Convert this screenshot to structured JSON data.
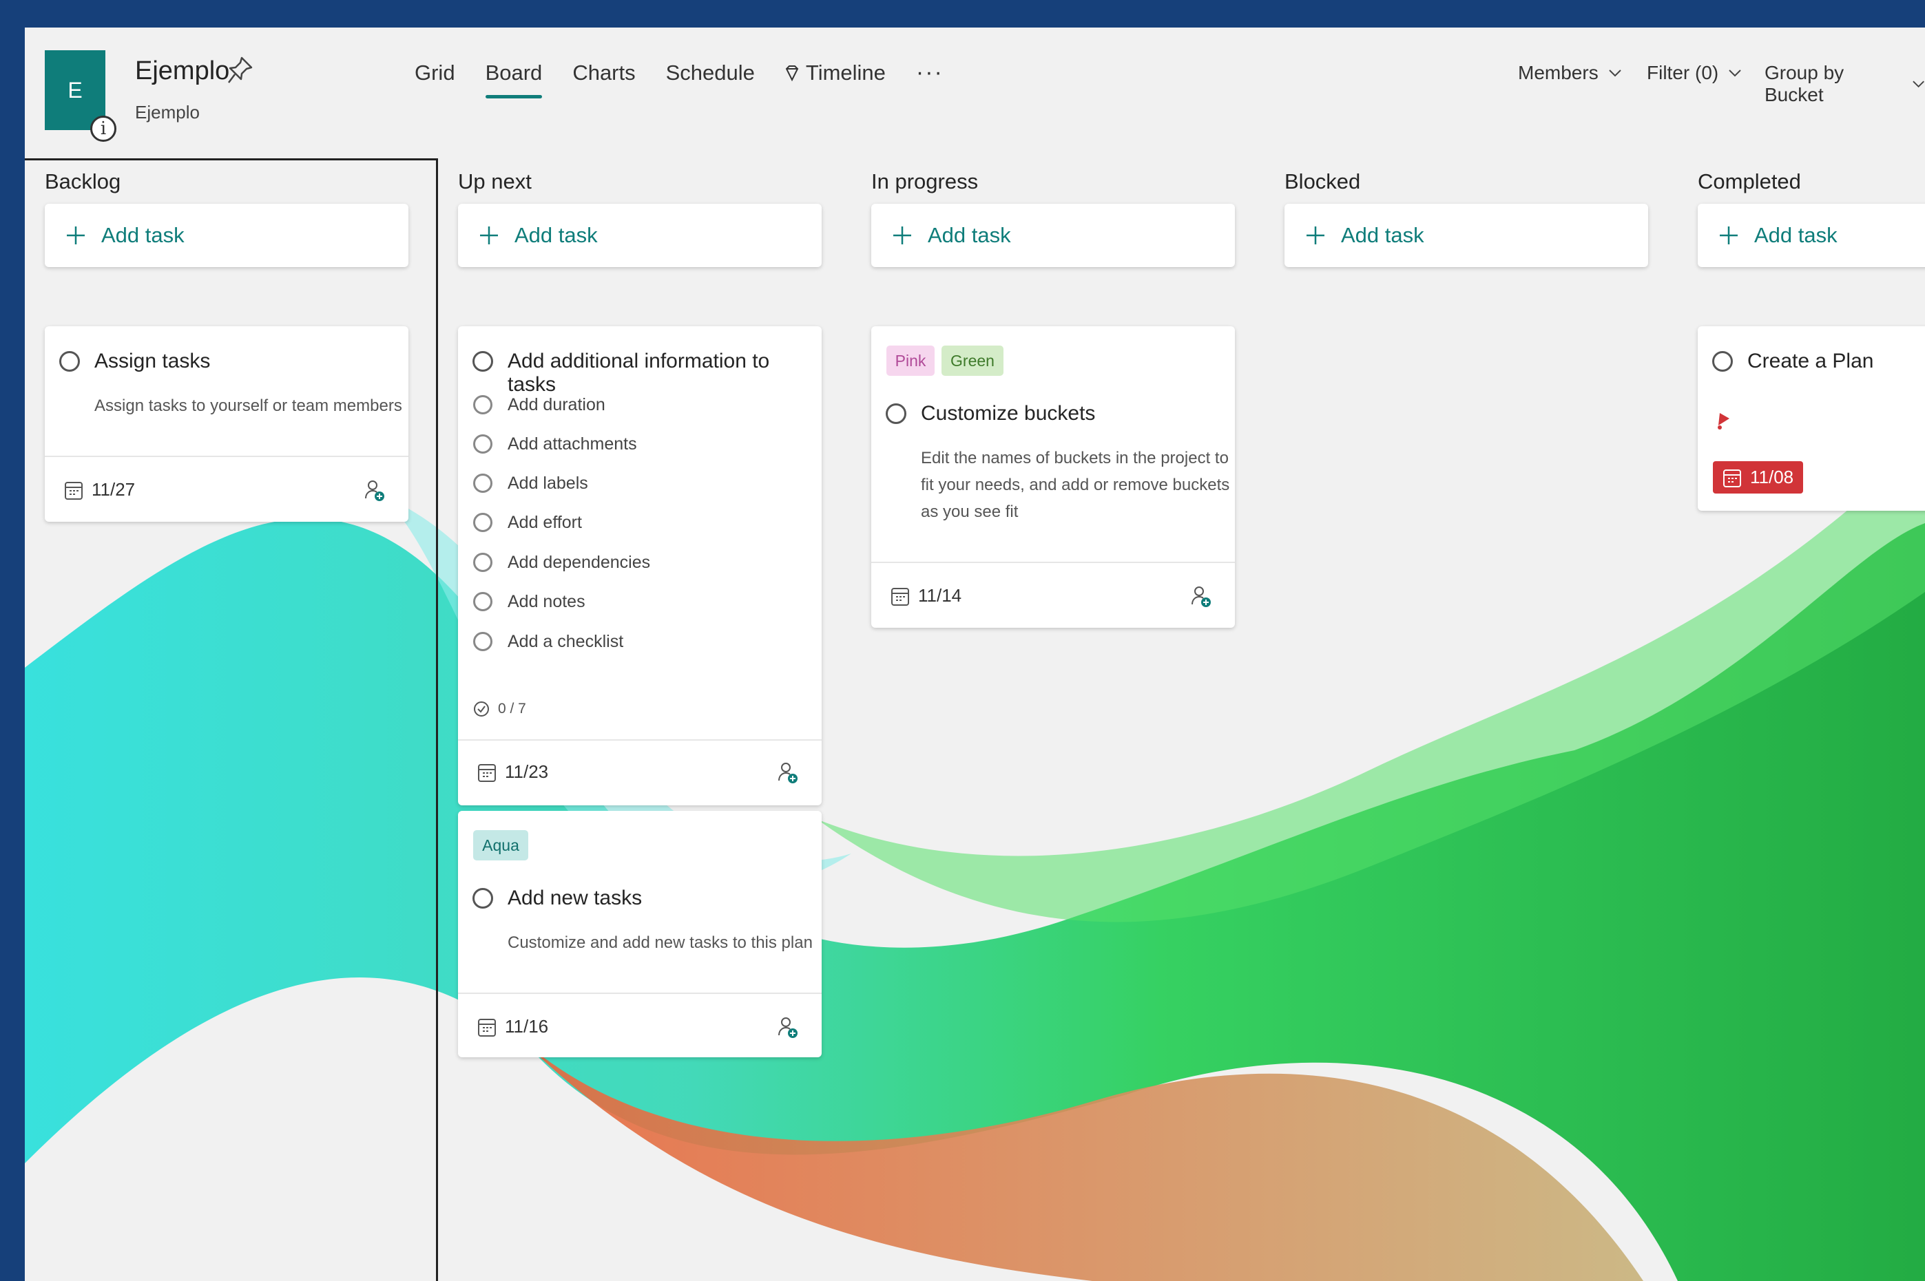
{
  "plan": {
    "initial": "E",
    "title": "Ejemplo",
    "subtitle": "Ejemplo"
  },
  "nav": {
    "tabs": [
      "Grid",
      "Board",
      "Charts",
      "Schedule",
      "Timeline"
    ],
    "active": "Board",
    "more": "···"
  },
  "controls": {
    "members": "Members",
    "filter": "Filter (0)",
    "group_by": "Group by Bucket"
  },
  "colors": {
    "accent": "#0f7d7a",
    "frame": "#16407a",
    "overdue": "#d13438"
  },
  "add_task_label": "Add task",
  "buckets": [
    {
      "name": "Backlog"
    },
    {
      "name": "Up next"
    },
    {
      "name": "In progress"
    },
    {
      "name": "Blocked"
    },
    {
      "name": "Completed"
    }
  ],
  "tasks": {
    "assign": {
      "title": "Assign tasks",
      "desc": "Assign tasks to yourself or team members",
      "date": "11/27"
    },
    "additional": {
      "title": "Add additional information to tasks",
      "checklist": [
        "Add duration",
        "Add attachments",
        "Add labels",
        "Add effort",
        "Add dependencies",
        "Add notes",
        "Add a checklist"
      ],
      "progress": "0 / 7",
      "date": "11/23"
    },
    "new_tasks": {
      "label": "Aqua",
      "title": "Add new tasks",
      "desc": "Customize and add new tasks to this plan",
      "date": "11/16"
    },
    "customize": {
      "labels": [
        "Pink",
        "Green"
      ],
      "title": "Customize buckets",
      "desc_lines": [
        "Edit the names of buckets in the project to",
        "fit your needs, and add or remove buckets",
        "as you see fit"
      ],
      "date": "11/14"
    },
    "create_plan": {
      "title": "Create a Plan",
      "date": "11/08",
      "priority_icon": "urgent-icon"
    }
  }
}
